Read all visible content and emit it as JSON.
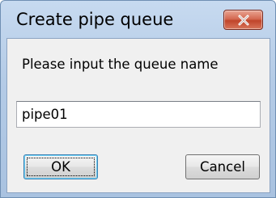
{
  "window": {
    "title": "Create pipe queue",
    "close_icon": "close-x-icon"
  },
  "dialog": {
    "prompt": "Please input the queue name",
    "queue_name_value": "pipe01",
    "ok_label": "OK",
    "cancel_label": "Cancel"
  },
  "colors": {
    "title_bar": "#b4cbe6",
    "close_button": "#c7503a",
    "dialog_background": "#f0f0f0",
    "default_button_border": "#3c7fb1"
  }
}
